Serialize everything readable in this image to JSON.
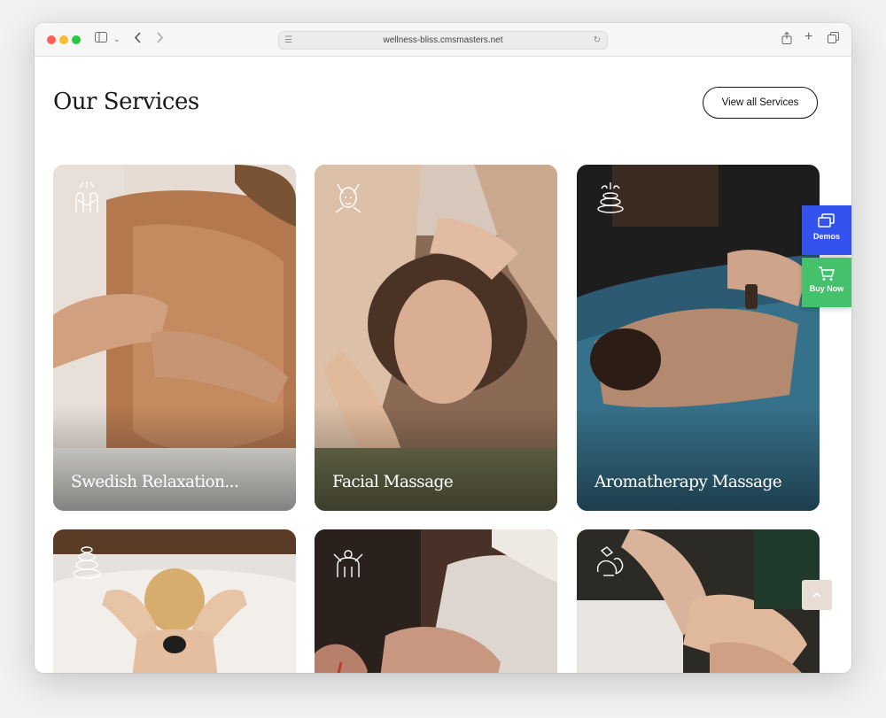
{
  "browser": {
    "url": "wellness-bliss.cmsmasters.net"
  },
  "section": {
    "title": "Our Services",
    "view_all_label": "View all Services"
  },
  "cards": [
    {
      "title": "Swedish Relaxation...",
      "icon": "massage-back-icon"
    },
    {
      "title": "Facial Massage",
      "icon": "facial-massage-icon"
    },
    {
      "title": "Aromatherapy Massage",
      "icon": "aroma-stones-icon"
    },
    {
      "title": "",
      "icon": "hot-stones-icon"
    },
    {
      "title": "",
      "icon": "shoulder-massage-icon"
    },
    {
      "title": "",
      "icon": "hand-massage-icon"
    }
  ],
  "floating": {
    "demos_label": "Demos",
    "buy_label": "Buy Now"
  },
  "colors": {
    "demos": "#3452ee",
    "buy": "#43c26b"
  }
}
